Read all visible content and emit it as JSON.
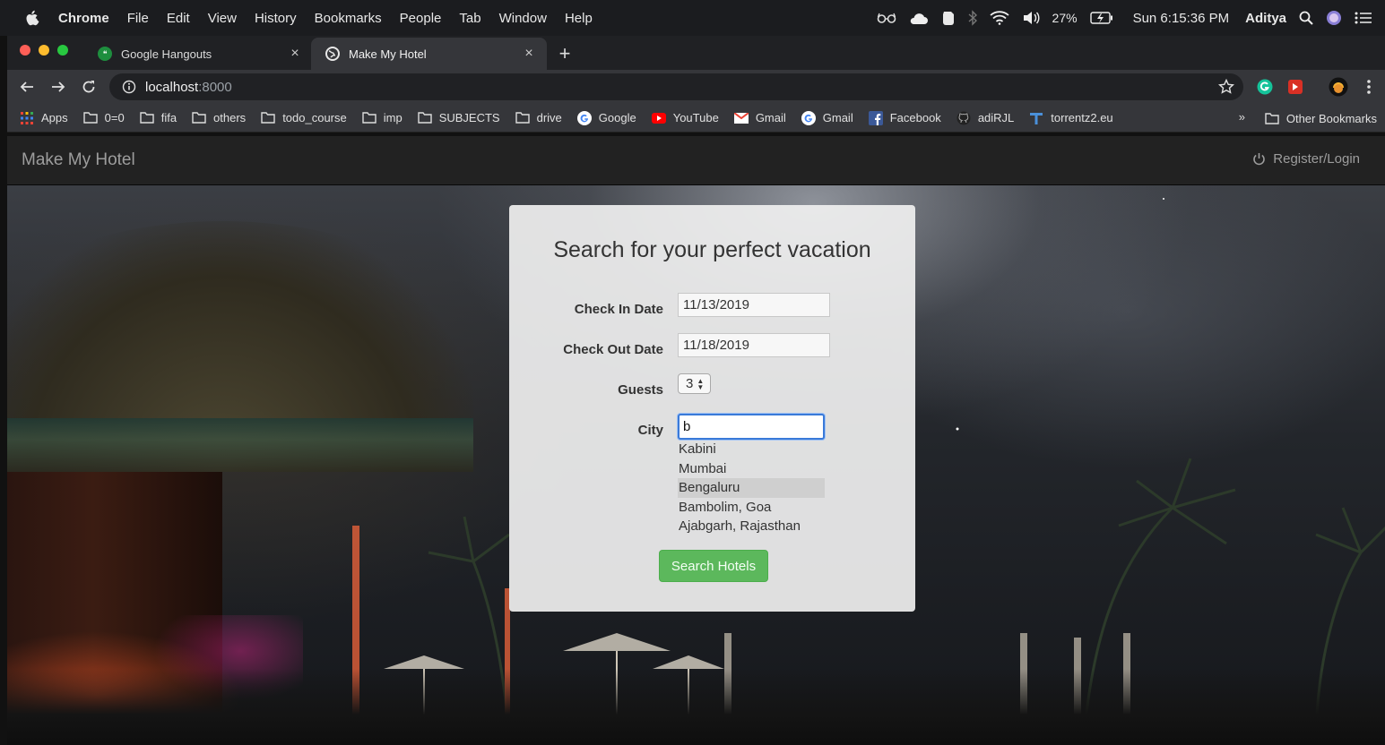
{
  "menubar": {
    "app": "Chrome",
    "items": [
      "File",
      "Edit",
      "View",
      "History",
      "Bookmarks",
      "People",
      "Tab",
      "Window",
      "Help"
    ],
    "battery": "27%",
    "clock": "Sun 6:15:36 PM",
    "user": "Aditya"
  },
  "tabs": [
    {
      "title": "Google Hangouts",
      "close": "×"
    },
    {
      "title": "Make My Hotel",
      "close": "×"
    }
  ],
  "newtab": "+",
  "address": {
    "host": "localhost",
    "port": ":8000"
  },
  "bookmarks": [
    {
      "label": "Apps",
      "icon": "apps-grid-icon"
    },
    {
      "label": "0=0",
      "icon": "folder-icon"
    },
    {
      "label": "fifa",
      "icon": "folder-icon"
    },
    {
      "label": "others",
      "icon": "folder-icon"
    },
    {
      "label": "todo_course",
      "icon": "folder-icon"
    },
    {
      "label": "imp",
      "icon": "folder-icon"
    },
    {
      "label": "SUBJECTS",
      "icon": "folder-icon"
    },
    {
      "label": "drive",
      "icon": "folder-icon"
    },
    {
      "label": "Google",
      "icon": "google-icon"
    },
    {
      "label": "YouTube",
      "icon": "youtube-icon"
    },
    {
      "label": "Gmail",
      "icon": "gmail-icon"
    },
    {
      "label": "Gmail",
      "icon": "google-icon"
    },
    {
      "label": "Facebook",
      "icon": "facebook-icon"
    },
    {
      "label": "adiRJL",
      "icon": "github-icon"
    },
    {
      "label": "torrentz2.eu",
      "icon": "torrentz-icon"
    }
  ],
  "bookmarks_more": "»",
  "other_bookmarks": "Other Bookmarks",
  "site": {
    "brand": "Make My Hotel",
    "register": "Register/Login"
  },
  "form": {
    "title": "Search for your perfect vacation",
    "checkin_label": "Check In Date",
    "checkin_value": "11/13/2019",
    "checkout_label": "Check Out Date",
    "checkout_value": "11/18/2019",
    "guests_label": "Guests",
    "guests_value": "3",
    "city_label": "City",
    "city_value": "b",
    "suggestions": [
      "Kabini",
      "Mumbai",
      "Bengaluru",
      "Bambolim, Goa",
      "Ajabgarh, Rajasthan"
    ],
    "highlighted_index": 2,
    "search_label": "Search Hotels"
  },
  "colors": {
    "accent_button": "#5cb85c",
    "focus_ring": "#3a7ad8",
    "navbar": "#222222"
  }
}
